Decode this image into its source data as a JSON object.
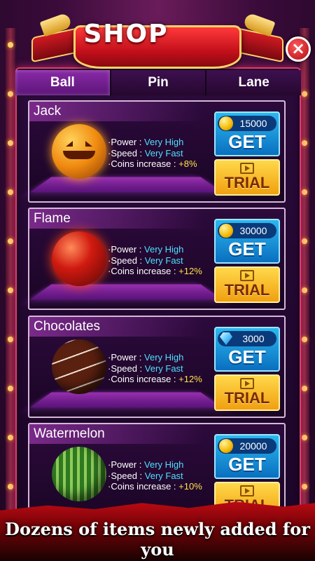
{
  "header": {
    "title": "SHOP",
    "close_label": "×"
  },
  "tabs": [
    {
      "label": "Ball",
      "active": true
    },
    {
      "label": "Pin",
      "active": false
    },
    {
      "label": "Lane",
      "active": false
    }
  ],
  "stat_labels": {
    "power": "·Power : ",
    "speed": "·Speed : ",
    "coins": "·Coins increase : "
  },
  "items": [
    {
      "name": "Jack",
      "power": "Very High",
      "speed": "Very Fast",
      "coins_increase": "+8%",
      "price": "15000",
      "currency": "coin",
      "get_label": "GET",
      "trial_label": "TRIAL"
    },
    {
      "name": "Flame",
      "power": "Very High",
      "speed": "Very Fast",
      "coins_increase": "+12%",
      "price": "30000",
      "currency": "coin",
      "get_label": "GET",
      "trial_label": "TRIAL"
    },
    {
      "name": "Chocolates",
      "power": "Very High",
      "speed": "Very Fast",
      "coins_increase": "+12%",
      "price": "3000",
      "currency": "gem",
      "get_label": "GET",
      "trial_label": "TRIAL"
    },
    {
      "name": "Watermelon",
      "power": "Very High",
      "speed": "Very Fast",
      "coins_increase": "+10%",
      "price": "20000",
      "currency": "coin",
      "get_label": "GET",
      "trial_label": "TRIAL"
    }
  ],
  "banner": {
    "text": "Dozens of items newly added for you"
  },
  "colors": {
    "accent": "#e23b6a",
    "get_blue": "#0a6fc0",
    "trial_gold": "#f0a010",
    "stat_value": "#4fe0ff",
    "stat_percent": "#ffe24a"
  }
}
